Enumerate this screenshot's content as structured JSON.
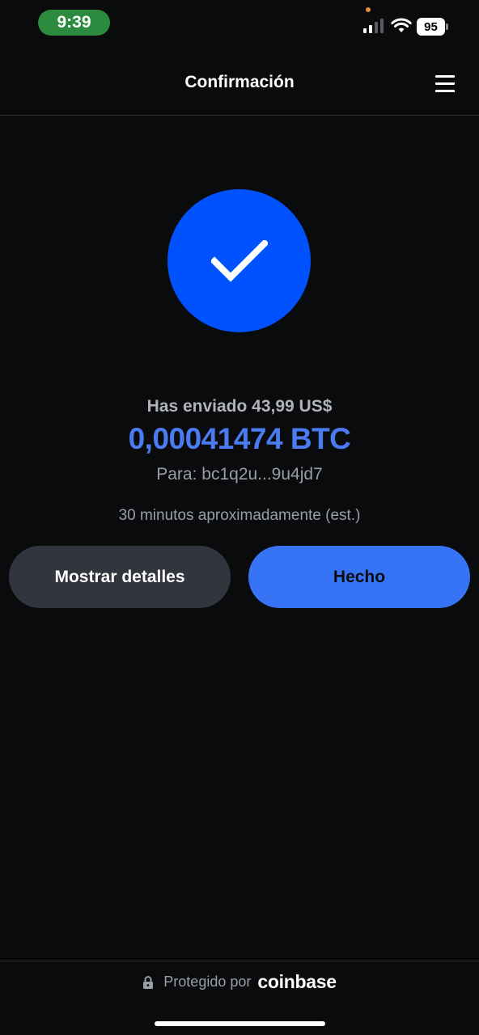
{
  "status_bar": {
    "time": "9:39",
    "battery": "95"
  },
  "header": {
    "title": "Confirmación",
    "menu_icon": "hamburger-menu-icon"
  },
  "confirmation": {
    "icon": "checkmark-icon",
    "sent_label": "Has enviado 43,99 US$",
    "amount": "0,00041474 BTC",
    "recipient": "Para: bc1q2u...9u4jd7",
    "eta": "30 minutos aproximadamente (est.)"
  },
  "actions": {
    "details_label": "Mostrar detalles",
    "done_label": "Hecho"
  },
  "footer": {
    "protected_text": "Protegido por",
    "brand": "coinbase"
  },
  "colors": {
    "background": "#0a0b0d",
    "accent": "#0052ff",
    "amount": "#4a7bf0",
    "done_button": "#3773f5",
    "details_button": "#32353d"
  }
}
